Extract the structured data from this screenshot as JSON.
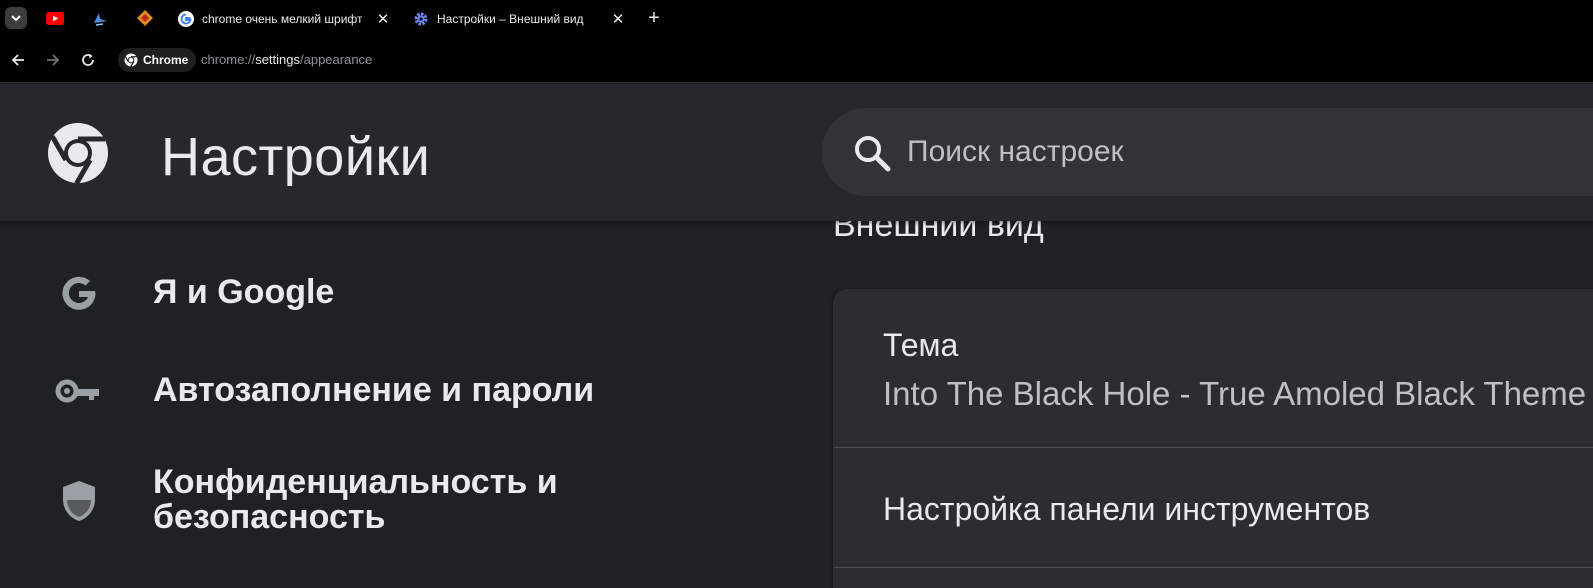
{
  "tabs": {
    "pinned": [
      {
        "icon": "youtube-icon",
        "color": "#ff0000"
      },
      {
        "icon": "bird-icon",
        "color": "#4a90e2"
      },
      {
        "icon": "badge-icon",
        "color": "#e08a1e"
      }
    ],
    "items": [
      {
        "title": "chrome очень мелкий шрифт в",
        "icon": "google-icon",
        "active": false
      },
      {
        "title": "Настройки – Внешний вид",
        "icon": "settings-icon",
        "active": true
      }
    ]
  },
  "toolbar": {
    "chip_label": "Chrome",
    "url_scheme": "chrome://",
    "url_host": "settings",
    "url_path": "/appearance"
  },
  "header": {
    "title": "Настройки",
    "search_placeholder": "Поиск настроек"
  },
  "sidebar": {
    "items": [
      {
        "label": "Я и Google",
        "icon": "google-g-icon"
      },
      {
        "label": "Автозаполнение и пароли",
        "icon": "key-icon"
      },
      {
        "label_line1": "Конфиденциальность и",
        "label_line2": "безопасность",
        "icon": "shield-icon"
      }
    ]
  },
  "main": {
    "section_title": "Внешний вид",
    "theme": {
      "label": "Тема",
      "value": "Into The Black Hole - True Amoled Black Theme"
    },
    "customize_toolbar_label": "Настройка панели инструментов"
  },
  "colors": {
    "background": "#202124",
    "header": "#27282b",
    "card": "#2c2d30",
    "text": "#e8eaed",
    "secondary_text": "#bdc1c6",
    "settings_icon_accent": "#8ab4f8"
  }
}
